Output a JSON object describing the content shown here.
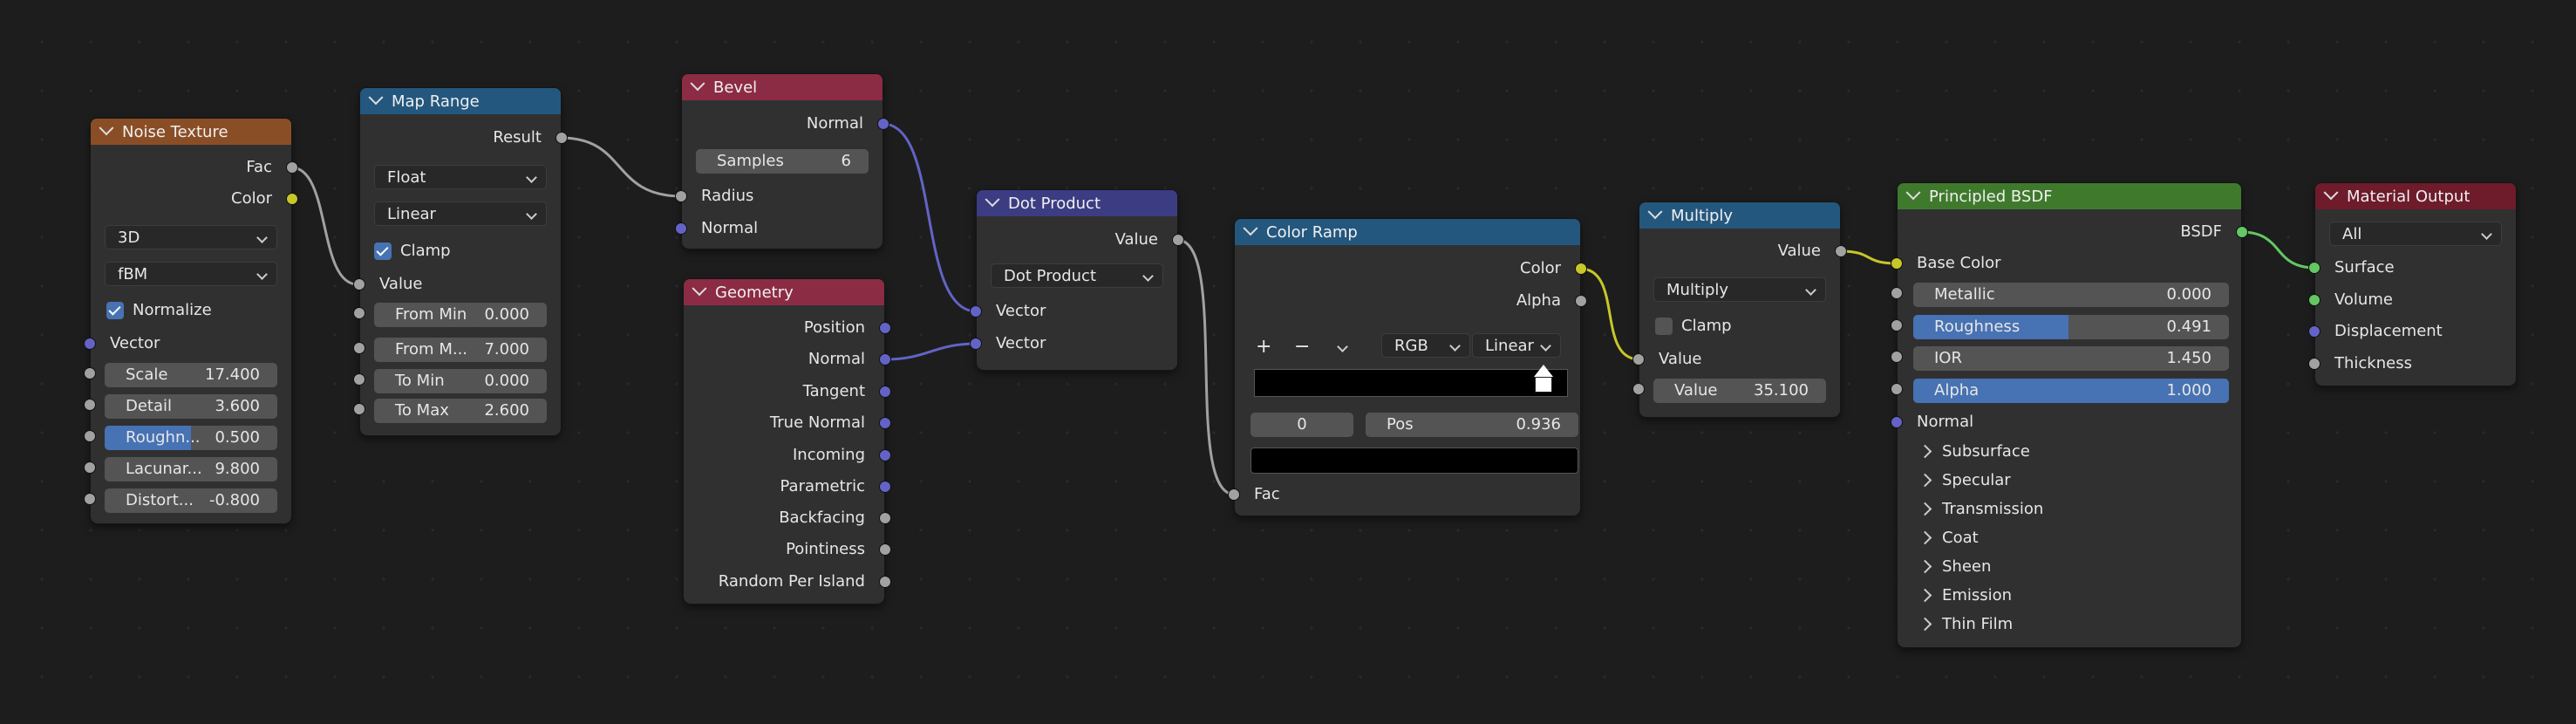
{
  "nodes": {
    "noise": {
      "title": "Noise Texture",
      "out_fac": "Fac",
      "out_color": "Color",
      "dim": "3D",
      "type": "fBM",
      "normalize": "Normalize",
      "vector": "Vector",
      "fields": [
        {
          "label": "Scale",
          "value": "17.400"
        },
        {
          "label": "Detail",
          "value": "3.600"
        },
        {
          "label": "Roughn...",
          "value": "0.500",
          "fill": 0.5
        },
        {
          "label": "Lacunar...",
          "value": "9.800"
        },
        {
          "label": "Distort...",
          "value": "-0.800"
        }
      ]
    },
    "maprange": {
      "title": "Map Range",
      "out_result": "Result",
      "data_type": "Float",
      "interp": "Linear",
      "clamp": "Clamp",
      "in_value": "Value",
      "fields": [
        {
          "label": "From Min",
          "value": "0.000"
        },
        {
          "label": "From M...",
          "value": "7.000"
        },
        {
          "label": "To Min",
          "value": "0.000"
        },
        {
          "label": "To Max",
          "value": "2.600"
        }
      ]
    },
    "bevel": {
      "title": "Bevel",
      "out_normal": "Normal",
      "samples_label": "Samples",
      "samples_value": "6",
      "in_radius": "Radius",
      "in_normal": "Normal"
    },
    "geometry": {
      "title": "Geometry",
      "outputs": [
        "Position",
        "Normal",
        "Tangent",
        "True Normal",
        "Incoming",
        "Parametric",
        "Backfacing",
        "Pointiness",
        "Random Per Island"
      ]
    },
    "dot": {
      "title": "Dot Product",
      "out_value": "Value",
      "op": "Dot Product",
      "in_vector1": "Vector",
      "in_vector2": "Vector"
    },
    "ramp": {
      "title": "Color Ramp",
      "out_color": "Color",
      "out_alpha": "Alpha",
      "plus": "+",
      "minus": "−",
      "mode": "RGB",
      "interp": "Linear",
      "index": "0",
      "pos_label": "Pos",
      "pos_value": "0.936",
      "in_fac": "Fac"
    },
    "multiply": {
      "title": "Multiply",
      "out_value": "Value",
      "op": "Multiply",
      "clamp": "Clamp",
      "in_value": "Value",
      "value_label": "Value",
      "value_value": "35.100"
    },
    "bsdf": {
      "title": "Principled BSDF",
      "out_bsdf": "BSDF",
      "base_color": "Base Color",
      "fields": [
        {
          "label": "Metallic",
          "value": "0.000",
          "fill": 0
        },
        {
          "label": "Roughness",
          "value": "0.491",
          "fill": 0.491
        },
        {
          "label": "IOR",
          "value": "1.450",
          "fill": 0
        },
        {
          "label": "Alpha",
          "value": "1.000",
          "fill": 1
        }
      ],
      "normal": "Normal",
      "panels": [
        "Subsurface",
        "Specular",
        "Transmission",
        "Coat",
        "Sheen",
        "Emission",
        "Thin Film"
      ]
    },
    "output": {
      "title": "Material Output",
      "target": "All",
      "inputs": [
        "Surface",
        "Volume",
        "Displacement",
        "Thickness"
      ]
    }
  },
  "colors": {
    "texture": "#8a4e26",
    "converter": "#24577e",
    "vector": "#8c2b44",
    "math_vec": "#3c3c83",
    "shader": "#3f7a2c",
    "output": "#6e1b2b",
    "accent": "#4772b3"
  }
}
